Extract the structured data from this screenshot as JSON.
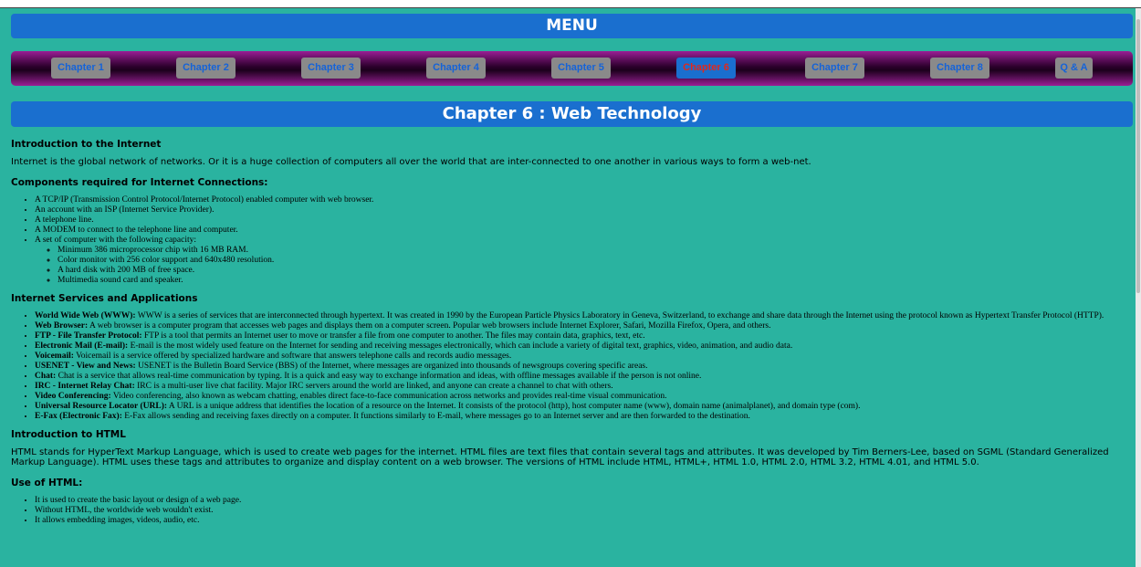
{
  "menu": {
    "title": "MENU"
  },
  "nav": {
    "items": [
      {
        "label": "Chapter 1"
      },
      {
        "label": "Chapter 2"
      },
      {
        "label": "Chapter 3"
      },
      {
        "label": "Chapter 4"
      },
      {
        "label": "Chapter 5"
      },
      {
        "label": "Chapter 6"
      },
      {
        "label": "Chapter 7"
      },
      {
        "label": "Chapter 8"
      },
      {
        "label": "Q & A"
      }
    ]
  },
  "chapter": {
    "title": "Chapter 6 : Web Technology"
  },
  "sections": {
    "intro_internet": {
      "heading": "Introduction to the Internet",
      "text": "Internet is the global network of networks. Or it is a huge collection of computers all over the world that are inter-connected to one another in various ways to form a web-net."
    },
    "components": {
      "heading": "Components required for Internet Connections:",
      "items": [
        "A TCP/IP (Transmission Control Protocol/Internet Protocol) enabled computer with web browser.",
        "An account with an ISP (Internet Service Provider).",
        "A telephone line.",
        "A MODEM to connect to the telephone line and computer.",
        "A set of computer with the following capacity:"
      ],
      "subitems": [
        "Minimum 386 microprocessor chip with 16 MB RAM.",
        "Color monitor with 256 color support and 640x480 resolution.",
        "A hard disk with 200 MB of free space.",
        "Multimedia sound card and speaker."
      ]
    },
    "services": {
      "heading": "Internet Services and Applications",
      "items": [
        {
          "term": "World Wide Web (WWW):",
          "desc": " WWW is a series of services that are interconnected through hypertext. It was created in 1990 by the European Particle Physics Laboratory in Geneva, Switzerland, to exchange and share data through the Internet using the protocol known as Hypertext Transfer Protocol (HTTP)."
        },
        {
          "term": "Web Browser:",
          "desc": " A web browser is a computer program that accesses web pages and displays them on a computer screen. Popular web browsers include Internet Explorer, Safari, Mozilla Firefox, Opera, and others."
        },
        {
          "term": "FTP - File Transfer Protocol:",
          "desc": " FTP is a tool that permits an Internet user to move or transfer a file from one computer to another. The files may contain data, graphics, text, etc."
        },
        {
          "term": "Electronic Mail (E-mail):",
          "desc": " E-mail is the most widely used feature on the Internet for sending and receiving messages electronically, which can include a variety of digital text, graphics, video, animation, and audio data."
        },
        {
          "term": "Voicemail:",
          "desc": " Voicemail is a service offered by specialized hardware and software that answers telephone calls and records audio messages."
        },
        {
          "term": "USENET - View and News:",
          "desc": " USENET is the Bulletin Board Service (BBS) of the Internet, where messages are organized into thousands of newsgroups covering specific areas."
        },
        {
          "term": "Chat:",
          "desc": " Chat is a service that allows real-time communication by typing. It is a quick and easy way to exchange information and ideas, with offline messages available if the person is not online."
        },
        {
          "term": "IRC - Internet Relay Chat:",
          "desc": " IRC is a multi-user live chat facility. Major IRC servers around the world are linked, and anyone can create a channel to chat with others."
        },
        {
          "term": "Video Conferencing:",
          "desc": " Video conferencing, also known as webcam chatting, enables direct face-to-face communication across networks and provides real-time visual communication."
        },
        {
          "term": "Universal Resource Locator (URL):",
          "desc": " A URL is a unique address that identifies the location of a resource on the Internet. It consists of the protocol (http), host computer name (www), domain name (animalplanet), and domain type (com)."
        },
        {
          "term": "E-Fax (Electronic Fax):",
          "desc": " E-Fax allows sending and receiving faxes directly on a computer. It functions similarly to E-mail, where messages go to an Internet server and are then forwarded to the destination."
        }
      ]
    },
    "intro_html": {
      "heading": "Introduction to HTML",
      "text": "HTML stands for HyperText Markup Language, which is used to create web pages for the internet. HTML files are text files that contain several tags and attributes. It was developed by Tim Berners-Lee, based on SGML (Standard Generalized Markup Language). HTML uses these tags and attributes to organize and display content on a web browser. The versions of HTML include HTML, HTML+, HTML 1.0, HTML 2.0, HTML 3.2, HTML 4.01, and HTML 5.0."
    },
    "use_html": {
      "heading": "Use of HTML:",
      "items": [
        "It is used to create the basic layout or design of a web page.",
        "Without HTML, the worldwide web wouldn't exist.",
        "It allows embedding images, videos, audio, etc."
      ]
    }
  }
}
